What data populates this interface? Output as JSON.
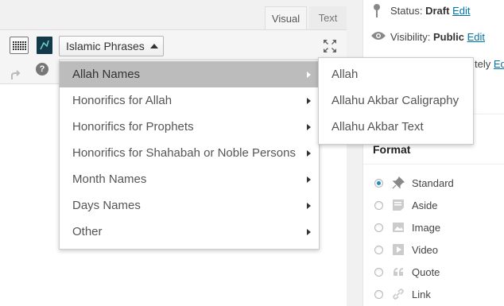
{
  "editor": {
    "tabs": [
      {
        "label": "Visual",
        "active": true
      },
      {
        "label": "Text",
        "active": false
      }
    ],
    "toolbar": {
      "phrases_button_label": "Islamic Phrases",
      "help_label": "?"
    }
  },
  "dropdown": {
    "items": [
      {
        "label": "Allah Names",
        "active": true
      },
      {
        "label": "Honorifics for Allah"
      },
      {
        "label": "Honorifics for Prophets"
      },
      {
        "label": "Honorifics for Shahabah or Noble Persons"
      },
      {
        "label": "Month Names"
      },
      {
        "label": "Days Names"
      },
      {
        "label": "Other"
      }
    ],
    "submenu": [
      {
        "label": "Allah"
      },
      {
        "label": "Allahu Akbar Caligraphy"
      },
      {
        "label": "Allahu Akbar Text"
      }
    ]
  },
  "sidebar": {
    "status_label": "Status:",
    "status_value": "Draft",
    "status_edit": "Edit",
    "visibility_label": "Visibility:",
    "visibility_value": "Public",
    "visibility_edit": "Edit",
    "publish_partial": "tely",
    "publish_edit_partial": "Ed",
    "format_title": "Format",
    "formats": [
      {
        "label": "Standard",
        "icon": "pin-icon",
        "selected": true
      },
      {
        "label": "Aside",
        "icon": "aside-icon",
        "selected": false
      },
      {
        "label": "Image",
        "icon": "image-icon",
        "selected": false
      },
      {
        "label": "Video",
        "icon": "video-icon",
        "selected": false
      },
      {
        "label": "Quote",
        "icon": "quote-icon",
        "selected": false
      },
      {
        "label": "Link",
        "icon": "link-icon",
        "selected": false
      }
    ]
  },
  "colors": {
    "link": "#0073aa",
    "active_menu_bg": "#bcbcbc",
    "radio_dot": "#1e8cbe"
  }
}
